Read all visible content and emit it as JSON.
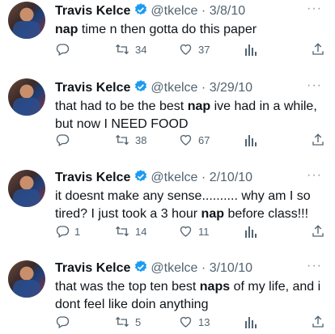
{
  "tweets": [
    {
      "name": "Travis Kelce",
      "handle": "@tkelce",
      "sep": "·",
      "date": "3/8/10",
      "more": "···",
      "text_before": "",
      "highlight": "nap",
      "text_after": " time n then gotta do this paper",
      "reply_count": "",
      "retweet_count": "34",
      "like_count": "37"
    },
    {
      "name": "Travis Kelce",
      "handle": "@tkelce",
      "sep": "·",
      "date": "3/29/10",
      "more": "···",
      "text_before": "that had to be the best ",
      "highlight": "nap",
      "text_after": " ive had in a while, but now I NEED FOOD",
      "reply_count": "",
      "retweet_count": "38",
      "like_count": "67"
    },
    {
      "name": "Travis Kelce",
      "handle": "@tkelce",
      "sep": "·",
      "date": "2/10/10",
      "more": "···",
      "text_before": "it doesnt make any sense.......... why am I so tired? I just took a 3 hour ",
      "highlight": "nap",
      "text_after": " before class!!!",
      "reply_count": "1",
      "retweet_count": "14",
      "like_count": "11"
    },
    {
      "name": "Travis Kelce",
      "handle": "@tkelce",
      "sep": "·",
      "date": "3/10/10",
      "more": "···",
      "text_before": "that was the top ten best ",
      "highlight": "naps",
      "text_after": " of my life, and i dont feel like doin anything",
      "reply_count": "",
      "retweet_count": "5",
      "like_count": "13"
    }
  ],
  "colors": {
    "verified": "#1d9bf0",
    "muted": "#536471",
    "text": "#0f1419"
  },
  "icons": [
    "reply-icon",
    "retweet-icon",
    "like-icon",
    "views-icon",
    "share-icon",
    "verified-icon"
  ]
}
